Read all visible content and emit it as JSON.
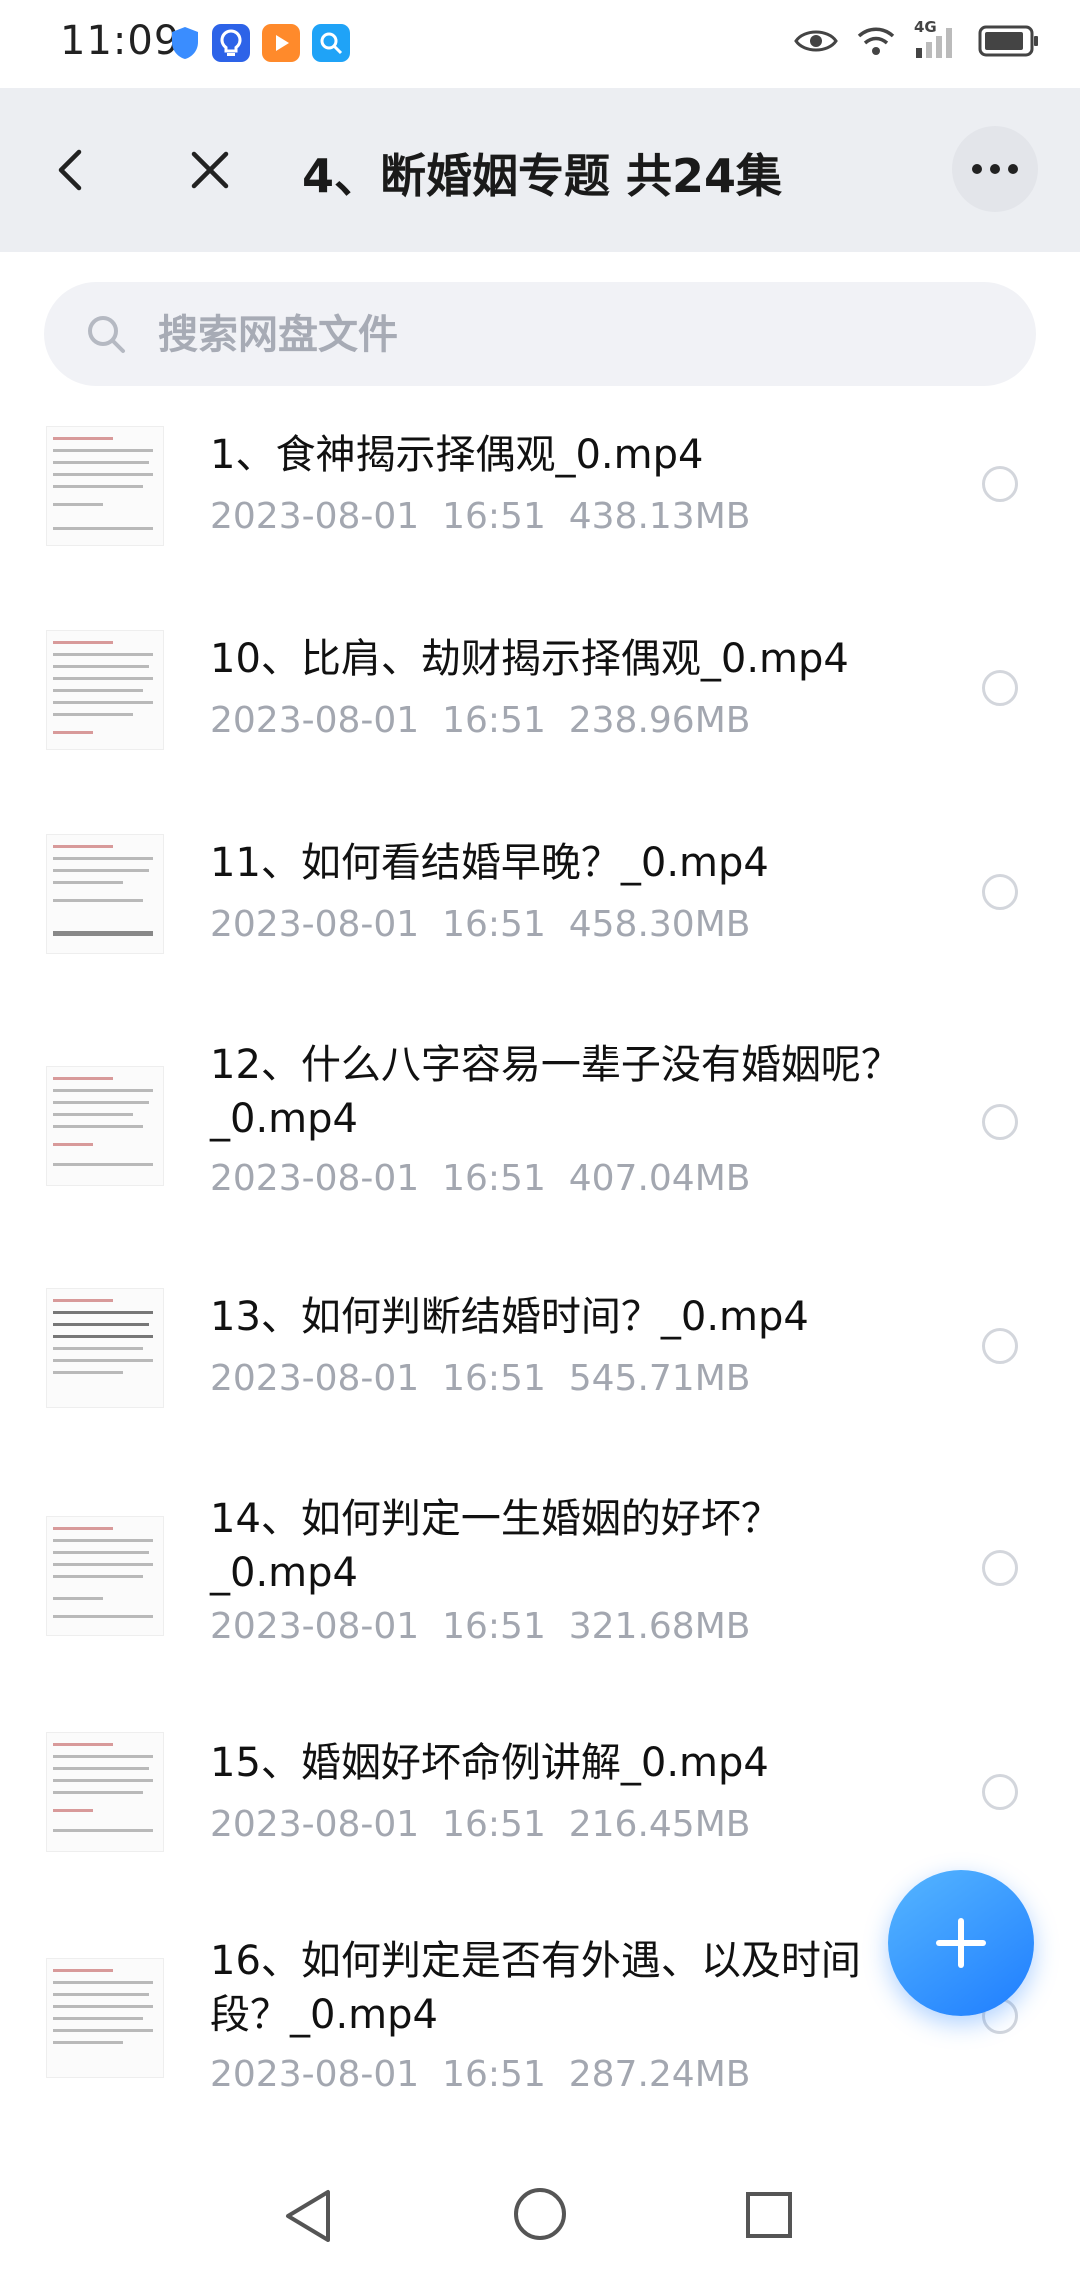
{
  "status_bar": {
    "time": "11:09",
    "network_label": "4G"
  },
  "header": {
    "title": "4、断婚姻专题 共24集"
  },
  "search": {
    "placeholder": "搜索网盘文件"
  },
  "files": [
    {
      "name": "1、食神揭示择偶观_0.mp4",
      "date": "2023-08-01",
      "time": "16:51",
      "size": "438.13MB"
    },
    {
      "name": "10、比肩、劫财揭示择偶观_0.mp4",
      "date": "2023-08-01",
      "time": "16:51",
      "size": "238.96MB"
    },
    {
      "name": "11、如何看结婚早晚？_0.mp4",
      "date": "2023-08-01",
      "time": "16:51",
      "size": "458.30MB"
    },
    {
      "name": "12、什么八字容易一辈子没有婚姻呢？_0.mp4",
      "date": "2023-08-01",
      "time": "16:51",
      "size": "407.04MB"
    },
    {
      "name": "13、如何判断结婚时间？_0.mp4",
      "date": "2023-08-01",
      "time": "16:51",
      "size": "545.71MB"
    },
    {
      "name": "14、如何判定一生婚姻的好坏？_0.mp4",
      "date": "2023-08-01",
      "time": "16:51",
      "size": "321.68MB"
    },
    {
      "name": "15、婚姻好坏命例讲解_0.mp4",
      "date": "2023-08-01",
      "time": "16:51",
      "size": "216.45MB"
    },
    {
      "name": "16、如何判定是否有外遇、以及时间段？_0.mp4",
      "date": "2023-08-01",
      "time": "16:51",
      "size": "287.24MB"
    }
  ],
  "colors": {
    "accent": "#1e7dff",
    "header_bg": "#eceef2",
    "meta_text": "#a3a7b0"
  },
  "icons": [
    "shield-icon",
    "bulb-icon",
    "play-icon",
    "search-app-icon",
    "eye-icon",
    "wifi-icon",
    "signal-icon",
    "battery-icon",
    "back-arrow-icon",
    "close-icon",
    "more-icon",
    "search-icon",
    "plus-icon"
  ]
}
